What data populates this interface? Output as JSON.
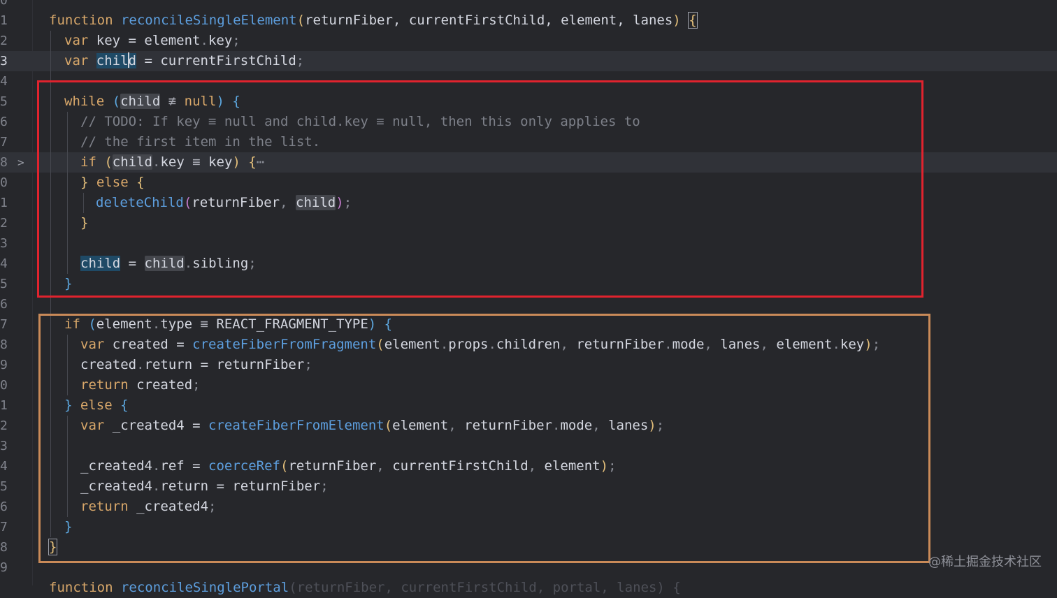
{
  "editor": {
    "function_keyword": "function",
    "function_name": "reconcileSingleElement",
    "params": "returnFiber, currentFirstChild, element, lanes",
    "lines": [
      {
        "number": "0"
      },
      {
        "number": "1"
      },
      {
        "number": "2"
      },
      {
        "number": "3"
      },
      {
        "number": "4"
      },
      {
        "number": "5"
      },
      {
        "number": "6"
      },
      {
        "number": "7"
      },
      {
        "number": "8"
      },
      {
        "number": "0"
      },
      {
        "number": "1"
      },
      {
        "number": "2"
      },
      {
        "number": "3"
      },
      {
        "number": "4"
      },
      {
        "number": "5"
      },
      {
        "number": "6"
      },
      {
        "number": "7"
      },
      {
        "number": "8"
      },
      {
        "number": "9"
      },
      {
        "number": "0"
      },
      {
        "number": "1"
      },
      {
        "number": "2"
      },
      {
        "number": "3"
      },
      {
        "number": "4"
      },
      {
        "number": "5"
      },
      {
        "number": "6"
      },
      {
        "number": "7"
      },
      {
        "number": "8"
      },
      {
        "number": "9"
      },
      {
        "number": ""
      }
    ],
    "current_line_index": 3,
    "folded_line_index": 8,
    "fold_marker": "⋯"
  },
  "watermark": "@稀土掘金技术社区"
}
